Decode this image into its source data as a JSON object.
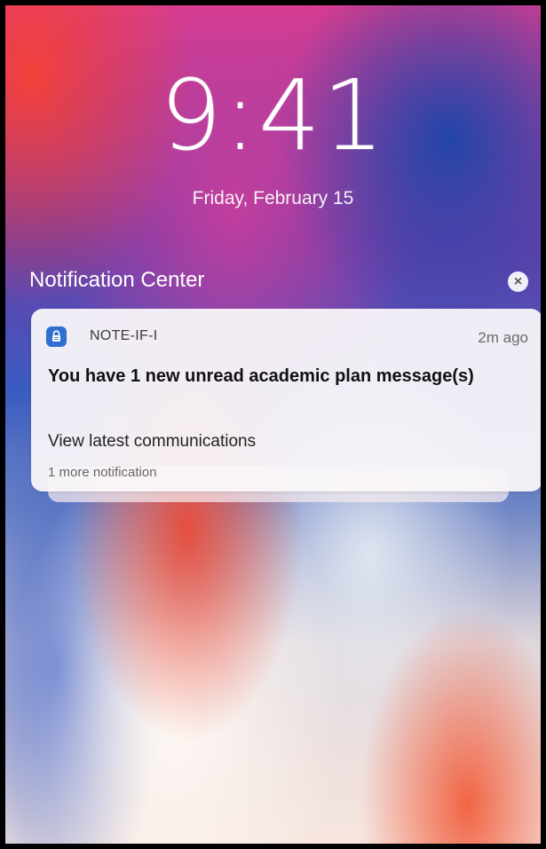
{
  "lock_screen": {
    "time": "9:41",
    "date": "Friday, February 15"
  },
  "notification_center": {
    "title": "Notification Center",
    "close_icon": "close-icon"
  },
  "notification": {
    "app_icon": "lock-icon",
    "app_name": "NOTE-IF-I",
    "time_ago": "2m ago",
    "title": "You have 1 new unread academic plan message(s)",
    "body": "View latest communications",
    "more": "1 more notification"
  },
  "colors": {
    "app_icon_bg": "#2f6fd1",
    "card_bg": "#faf7f9"
  }
}
